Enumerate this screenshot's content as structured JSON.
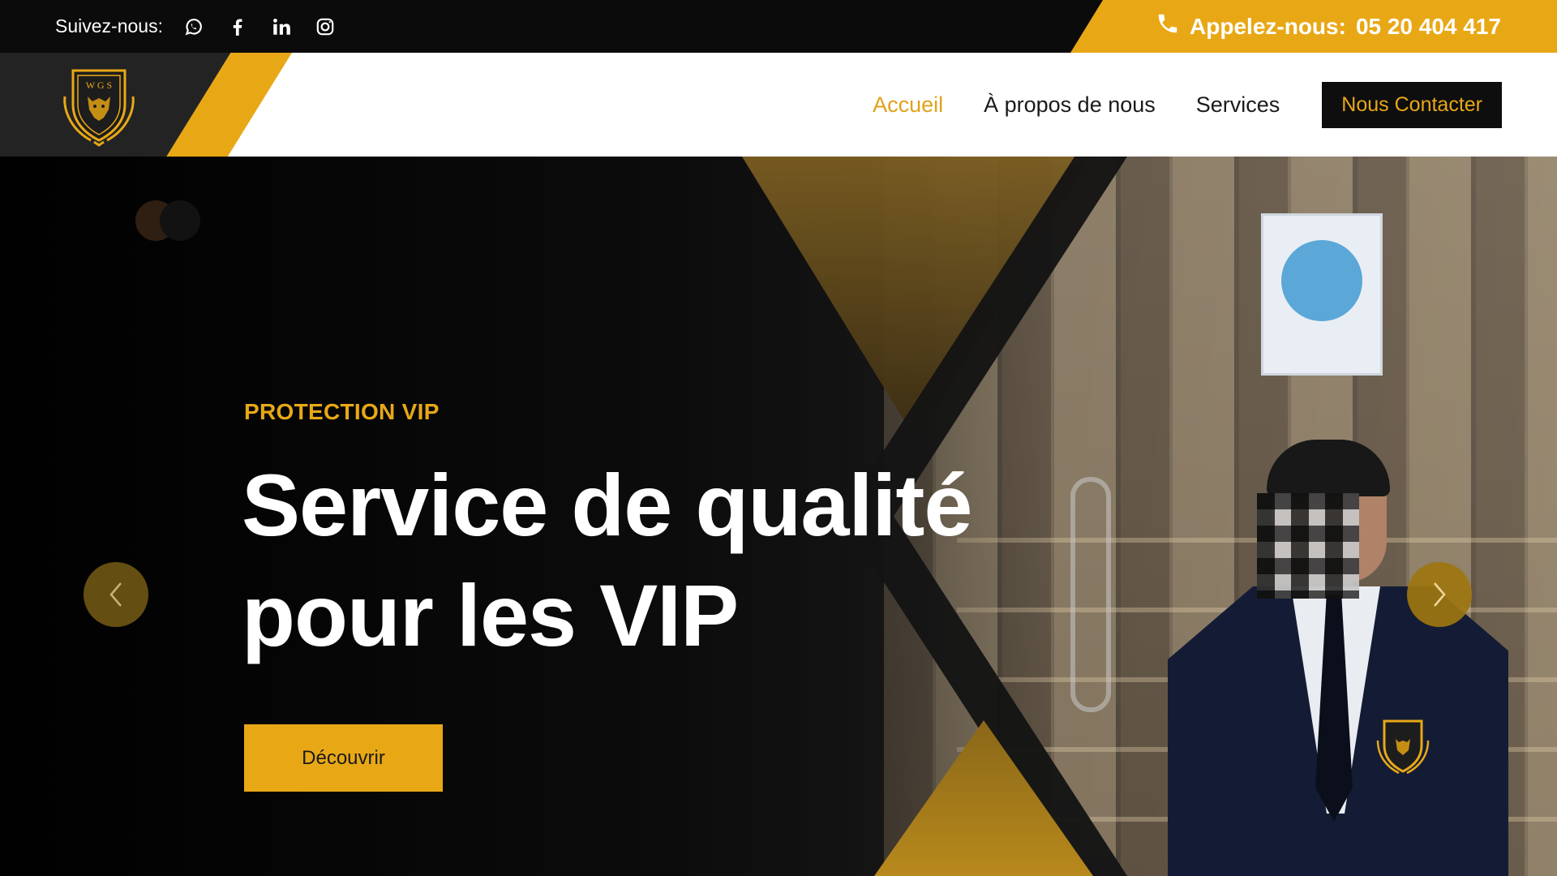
{
  "topbar": {
    "follow_label": "Suivez-nous:",
    "social_icons": [
      "whatsapp-icon",
      "facebook-icon",
      "linkedin-icon",
      "instagram-icon"
    ],
    "call_label": "Appelez-nous:",
    "phone": "05 20 404 417"
  },
  "header": {
    "logo_text": "W G S",
    "nav": {
      "home": "Accueil",
      "about": "À propos de nous",
      "services": "Services",
      "contact": "Nous Contacter"
    }
  },
  "hero": {
    "subtitle": "PROTECTION VIP",
    "title_line1": "Service de qualité",
    "title_line2": "pour les VIP",
    "cta": "Découvrir",
    "prev_icon": "chevron-left-icon",
    "next_icon": "chevron-right-icon"
  },
  "colors": {
    "accent": "#e8a816",
    "dark": "#0b0b0b",
    "nav_active": "#e0a21a",
    "white": "#ffffff"
  }
}
